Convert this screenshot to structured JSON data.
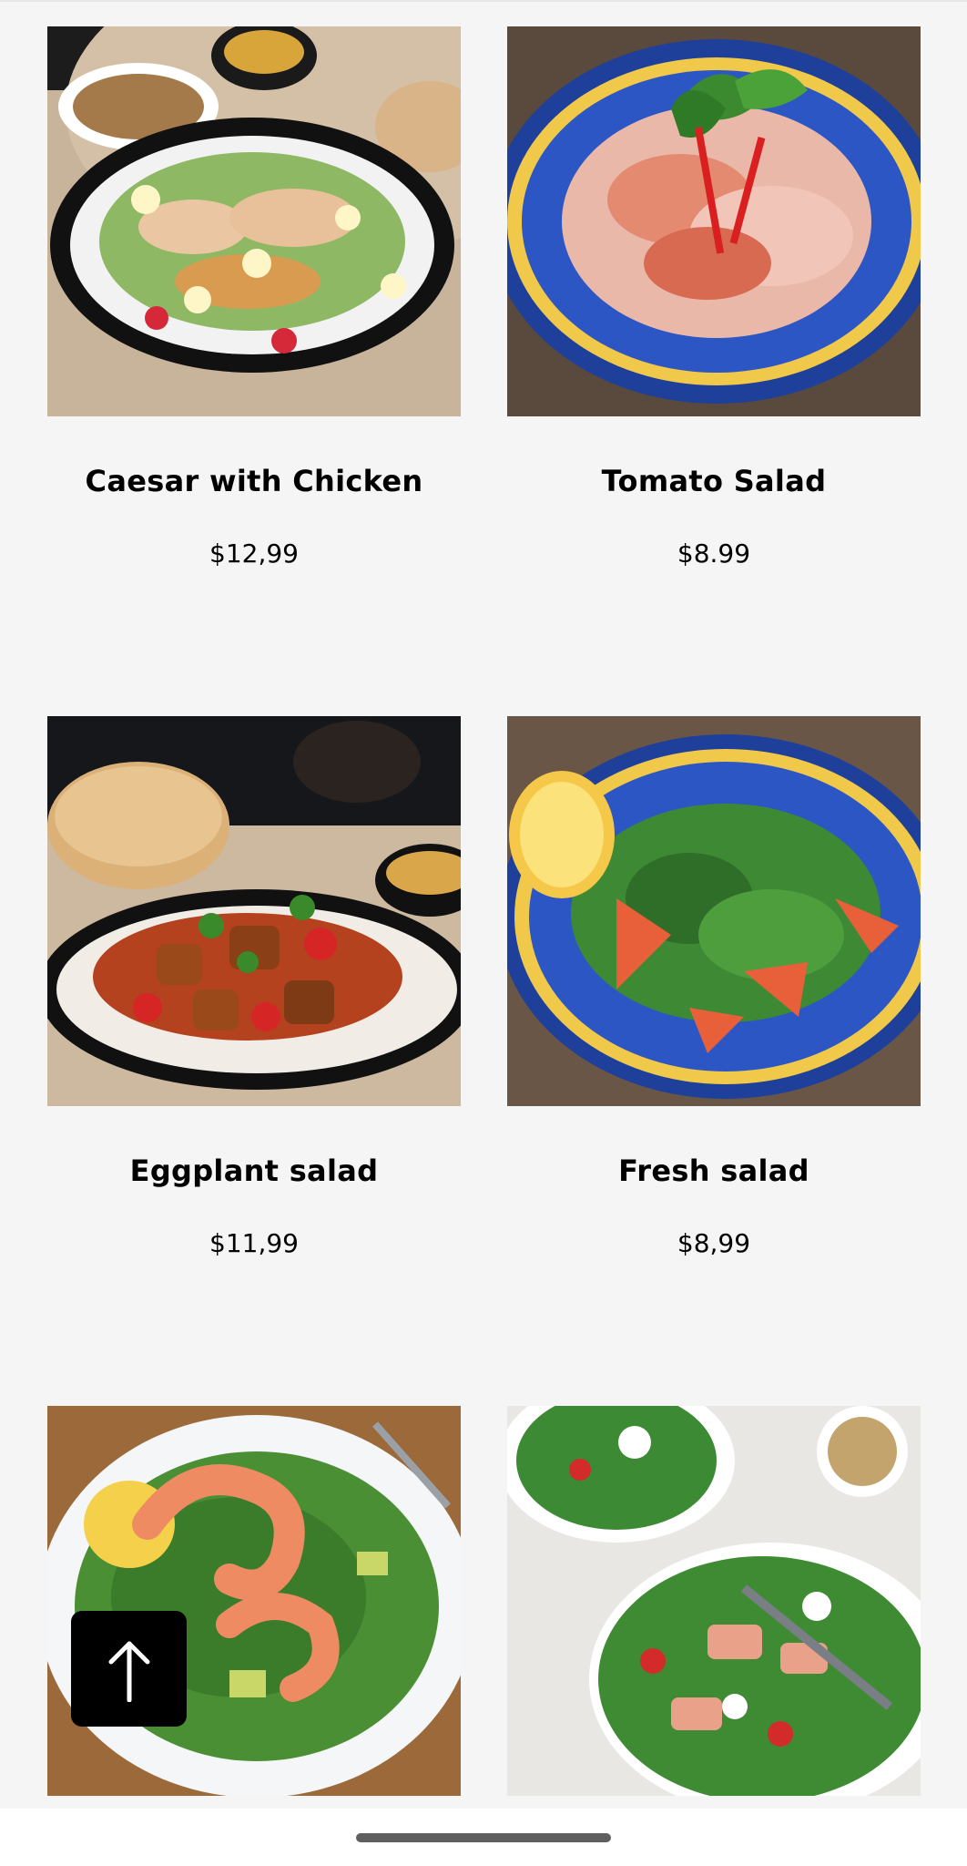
{
  "menu": {
    "items": [
      {
        "name": "Caesar with Chicken",
        "price": "$12,99",
        "image": "caesar-salad-photo"
      },
      {
        "name": "Tomato Salad",
        "price": "$8.99",
        "image": "tomato-salad-photo"
      },
      {
        "name": "Eggplant salad",
        "price": "$11,99",
        "image": "eggplant-salad-photo"
      },
      {
        "name": "Fresh salad",
        "price": "$8,99",
        "image": "fresh-salad-photo"
      },
      {
        "name": "",
        "price": "",
        "image": "shrimp-salad-photo"
      },
      {
        "name": "",
        "price": "",
        "image": "salmon-salad-photo"
      }
    ]
  },
  "scroll_top": {
    "icon": "arrow-up-icon"
  },
  "colors": {
    "background": "#f5f5f5",
    "fab": "#000000",
    "home_indicator": "#5f5f5f"
  }
}
